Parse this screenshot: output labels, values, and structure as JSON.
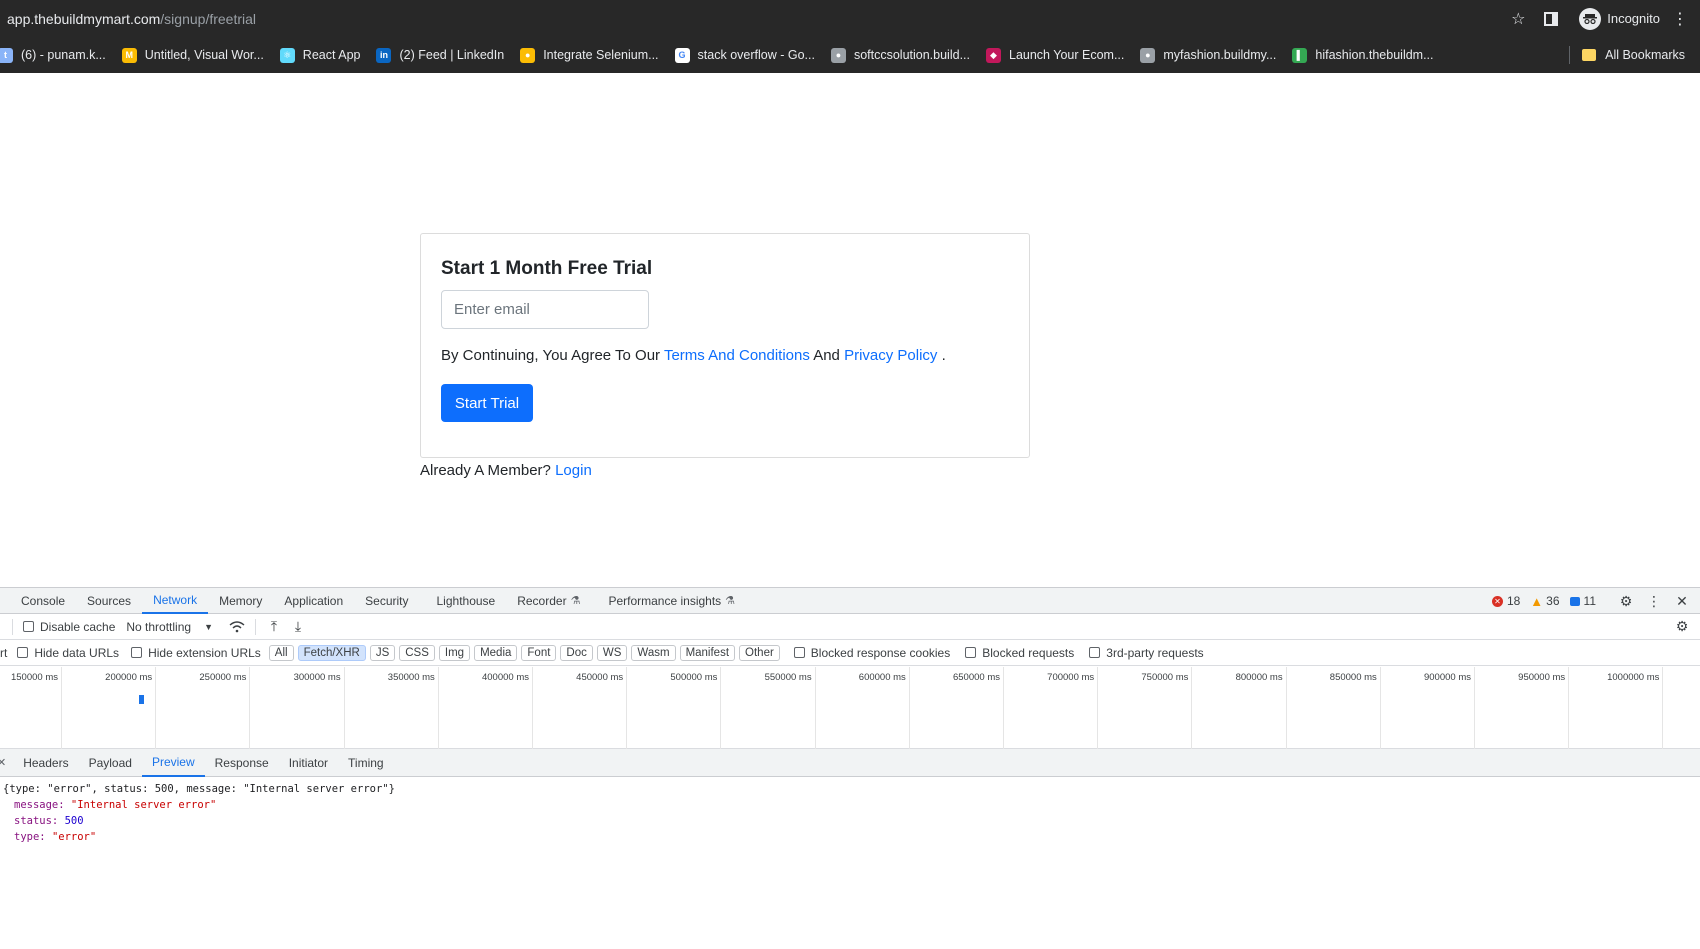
{
  "browser": {
    "url_host": "app.thebuildmymart.com",
    "url_path": "/signup/freetrial",
    "profile_label": "Incognito",
    "bookmarks": [
      {
        "label": "(6) - punam.k...",
        "color": "#8ab4f8",
        "glyph": "t"
      },
      {
        "label": "Untitled, Visual Wor...",
        "color": "#fbbc04",
        "glyph": "M"
      },
      {
        "label": "React App",
        "color": "#61dafb",
        "glyph": "⚛"
      },
      {
        "label": "(2) Feed | LinkedIn",
        "color": "#0a66c2",
        "glyph": "in"
      },
      {
        "label": "Integrate Selenium...",
        "color": "#fbbc04",
        "glyph": "●"
      },
      {
        "label": "stack overflow - Go...",
        "color": "#ffffff",
        "glyph": "G"
      },
      {
        "label": "softccsolution.build...",
        "color": "#9aa0a6",
        "glyph": "●"
      },
      {
        "label": "Launch Your Ecom...",
        "color": "#c2185b",
        "glyph": "◆"
      },
      {
        "label": "myfashion.buildmy...",
        "color": "#9aa0a6",
        "glyph": "●"
      },
      {
        "label": "hifashion.thebuildm...",
        "color": "#34a853",
        "glyph": "▌"
      }
    ],
    "all_bookmarks_label": "All Bookmarks"
  },
  "signup": {
    "title": "Start 1 Month Free Trial",
    "email_placeholder": "Enter email",
    "agree_prefix": "By Continuing, You Agree To Our",
    "terms_link": "Terms And Conditions",
    "and_text": "And",
    "privacy_link": "Privacy Policy",
    "period": ".",
    "start_button": "Start Trial",
    "member_text": "Already A Member?",
    "login_link": "Login"
  },
  "devtools": {
    "tabs": [
      "Console",
      "Sources",
      "Network",
      "Memory",
      "Application",
      "Security",
      "Lighthouse",
      "Recorder",
      "Performance insights"
    ],
    "active_tab": "Network",
    "error_count": "18",
    "warning_count": "36",
    "info_count": "11",
    "toolbar": {
      "disable_cache": "Disable cache",
      "throttling": "No throttling"
    },
    "filters": {
      "prefix": "rt",
      "hide_data_urls": "Hide data URLs",
      "hide_extension_urls": "Hide extension URLs",
      "types": [
        "All",
        "Fetch/XHR",
        "JS",
        "CSS",
        "Img",
        "Media",
        "Font",
        "Doc",
        "WS",
        "Wasm",
        "Manifest",
        "Other"
      ],
      "active_type": "Fetch/XHR",
      "blocked_cookies": "Blocked response cookies",
      "blocked_requests": "Blocked requests",
      "third_party": "3rd-party requests"
    },
    "timeline_ticks": [
      "150000 ms",
      "200000 ms",
      "250000 ms",
      "300000 ms",
      "350000 ms",
      "400000 ms",
      "450000 ms",
      "500000 ms",
      "550000 ms",
      "600000 ms",
      "650000 ms",
      "700000 ms",
      "750000 ms",
      "800000 ms",
      "850000 ms",
      "900000 ms",
      "950000 ms",
      "1000000 ms"
    ],
    "detail_tabs": [
      "Headers",
      "Payload",
      "Preview",
      "Response",
      "Initiator",
      "Timing"
    ],
    "active_detail_tab": "Preview",
    "preview": {
      "summary": "{type: \"error\", status: 500, message: \"Internal server error\"}",
      "message_key": "message:",
      "message_val": "\"Internal server error\"",
      "status_key": "status:",
      "status_val": "500",
      "type_key": "type:",
      "type_val": "\"error\""
    }
  }
}
